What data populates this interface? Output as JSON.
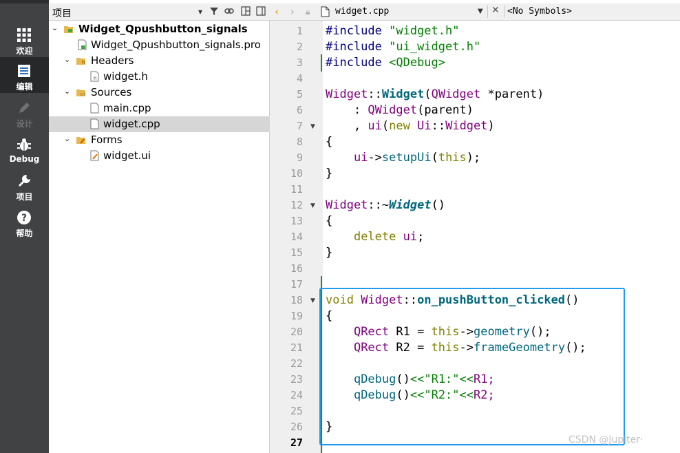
{
  "mode_sidebar": {
    "items": [
      {
        "label": "欢迎",
        "icon": "grid-icon",
        "active": false,
        "enabled": true
      },
      {
        "label": "编辑",
        "icon": "document-icon",
        "active": true,
        "enabled": true
      },
      {
        "label": "设计",
        "icon": "pencil-icon",
        "active": false,
        "enabled": false
      },
      {
        "label": "Debug",
        "icon": "bug-icon",
        "active": false,
        "enabled": true
      },
      {
        "label": "项目",
        "icon": "wrench-icon",
        "active": false,
        "enabled": true
      },
      {
        "label": "帮助",
        "icon": "help-icon",
        "active": false,
        "enabled": true
      }
    ]
  },
  "project_panel": {
    "title": "项目",
    "tree": [
      {
        "label": "Widget_Qpushbutton_signals",
        "type": "project-folder",
        "expanded": true
      },
      {
        "label": "Widget_Qpushbutton_signals.pro",
        "type": "pro-file"
      },
      {
        "label": "Headers",
        "type": "header-folder",
        "expanded": true
      },
      {
        "label": "widget.h",
        "type": "header-file"
      },
      {
        "label": "Sources",
        "type": "source-folder",
        "expanded": true
      },
      {
        "label": "main.cpp",
        "type": "source-file"
      },
      {
        "label": "widget.cpp",
        "type": "source-file",
        "selected": true
      },
      {
        "label": "Forms",
        "type": "form-folder",
        "expanded": true
      },
      {
        "label": "widget.ui",
        "type": "form-file"
      }
    ]
  },
  "editor": {
    "file_name": "widget.cpp",
    "symbols": "<No Symbols>",
    "current_line": "27",
    "line_numbers": [
      "1",
      "2",
      "3",
      "4",
      "5",
      "6",
      "7",
      "8",
      "9",
      "10",
      "11",
      "12",
      "13",
      "14",
      "15",
      "16",
      "17",
      "18",
      "19",
      "20",
      "21",
      "22",
      "23",
      "24",
      "25",
      "26",
      "27"
    ],
    "fold_lines": [
      "7",
      "12",
      "18"
    ],
    "code": {
      "l1_pre": "#include ",
      "l1_str": "\"widget.h\"",
      "l2_pre": "#include ",
      "l2_str": "\"ui_widget.h\"",
      "l3_pre": "#include ",
      "l3_str": "<QDebug>",
      "l5_a": "Widget",
      "l5_b": "::",
      "l5_c": "Widget",
      "l5_d": "(",
      "l5_e": "QWidget",
      "l5_f": " *parent)",
      "l6_a": "    : ",
      "l6_b": "QWidget",
      "l6_c": "(parent)",
      "l7_a": "    , ",
      "l7_b": "ui",
      "l7_c": "(",
      "l7_d": "new",
      "l7_e": " ",
      "l7_f": "Ui",
      "l7_g": "::",
      "l7_h": "Widget",
      "l7_i": ")",
      "l8": "{",
      "l9_a": "    ",
      "l9_b": "ui",
      "l9_c": "->",
      "l9_d": "setupUi",
      "l9_e": "(",
      "l9_f": "this",
      "l9_g": ");",
      "l10": "}",
      "l12_a": "Widget",
      "l12_b": "::~",
      "l12_c": "Widget",
      "l12_d": "()",
      "l13": "{",
      "l14_a": "    ",
      "l14_b": "delete",
      "l14_c": " ",
      "l14_d": "ui",
      "l14_e": ";",
      "l15": "}",
      "l18_a": "void",
      "l18_b": " ",
      "l18_c": "Widget",
      "l18_d": "::",
      "l18_e": "on_pushButton_clicked",
      "l18_f": "()",
      "l19": "{",
      "l20_a": "    ",
      "l20_b": "QRect",
      "l20_c": " R1 = ",
      "l20_d": "this",
      "l20_e": "->",
      "l20_f": "geometry",
      "l20_g": "();",
      "l21_a": "    ",
      "l21_b": "QRect",
      "l21_c": " R2 = ",
      "l21_d": "this",
      "l21_e": "->",
      "l21_f": "frameGeometry",
      "l21_g": "();",
      "l23_a": "    ",
      "l23_b": "qDebug",
      "l23_c": "()",
      "l23_d": "<<",
      "l23_e": "\"R1:\"",
      "l23_f": "<<",
      "l23_g": "R1;",
      "l24_a": "    ",
      "l24_b": "qDebug",
      "l24_c": "()",
      "l24_d": "<<",
      "l24_e": "\"R2:\"",
      "l24_f": "<<",
      "l24_g": "R2;",
      "l26": "}"
    }
  },
  "watermark": "CSDN @Jupiter·",
  "colors": {
    "sidebar_bg": "#404244",
    "sidebar_active": "#262829",
    "highlight_box": "#1e9af0",
    "keyword": "#808000",
    "type": "#800080",
    "string": "#008000",
    "function": "#00677c"
  }
}
